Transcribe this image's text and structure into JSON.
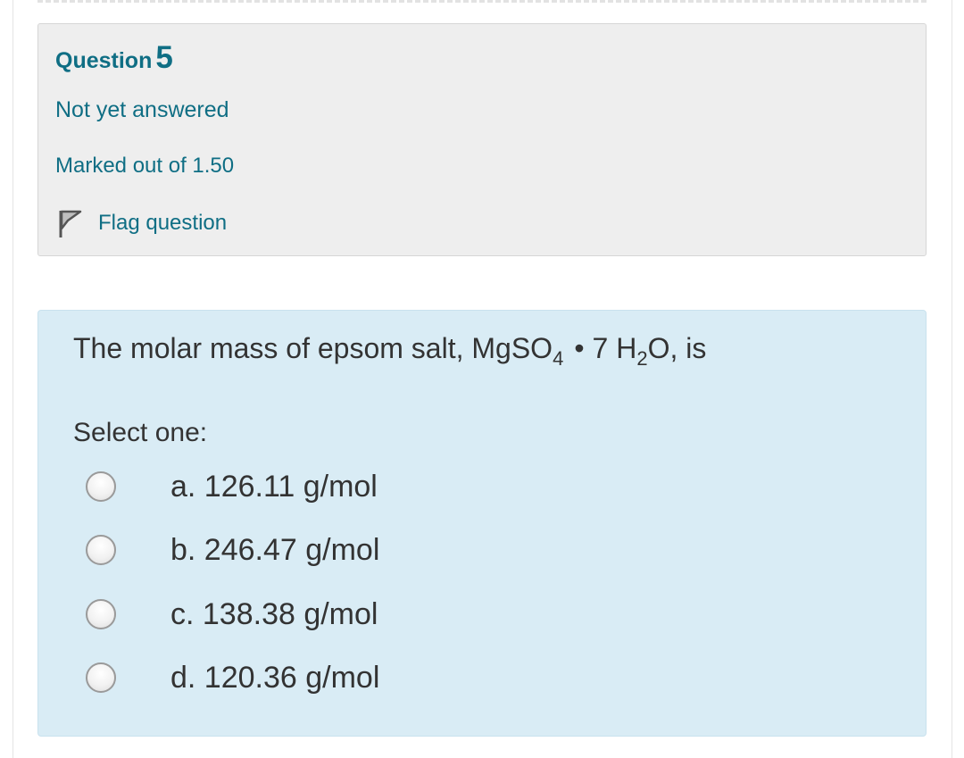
{
  "question_info": {
    "title_prefix": "Question",
    "number": "5",
    "state": "Not yet answered",
    "grade": "Marked out of 1.50",
    "flag_label": "Flag question",
    "flag_icon": "flag-icon"
  },
  "question": {
    "text_before": "The molar mass of epsom salt, MgSO",
    "sub1": "4",
    "dot": "•",
    "text_middle": "7 H",
    "sub2": "2",
    "text_after": "O, is",
    "prompt": "Select one:",
    "options": [
      {
        "label": "a. 126.11 g/mol",
        "selected": false
      },
      {
        "label": "b. 246.47 g/mol",
        "selected": false
      },
      {
        "label": "c. 138.38 g/mol",
        "selected": false
      },
      {
        "label": "d. 120.36 g/mol",
        "selected": false
      }
    ]
  },
  "colors": {
    "link_teal": "#0f6e84",
    "info_bg": "#eeeeee",
    "content_bg": "#d9ecf5",
    "text": "#333333"
  }
}
